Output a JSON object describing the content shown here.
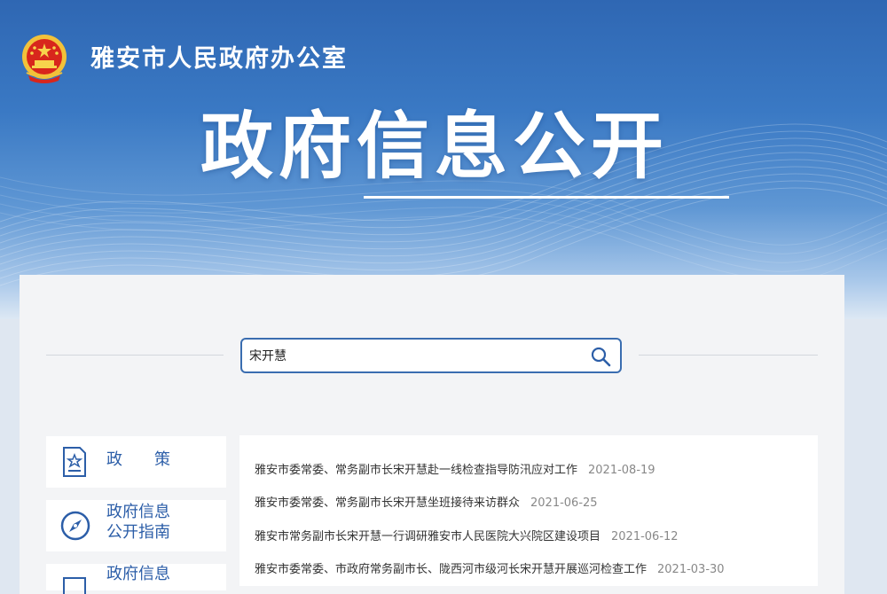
{
  "header": {
    "org_name": "雅安市人民政府办公室",
    "page_title": "政府信息公开"
  },
  "search": {
    "value": "宋开慧",
    "placeholder": ""
  },
  "sidebar": {
    "items": [
      {
        "label": "政　　策",
        "icon": "document-star-icon"
      },
      {
        "label_line1": "政府信息",
        "label_line2": "公开指南",
        "icon": "compass-icon"
      },
      {
        "label_line1": "政府信息",
        "icon": "document-icon"
      }
    ]
  },
  "news": {
    "items": [
      {
        "title": "雅安市委常委、常务副市长宋开慧赴一线检查指导防汛应对工作",
        "date": "2021-08-19"
      },
      {
        "title": "雅安市委常委、常务副市长宋开慧坐班接待来访群众",
        "date": "2021-06-25"
      },
      {
        "title": "雅安市常务副市长宋开慧一行调研雅安市人民医院大兴院区建设项目",
        "date": "2021-06-12"
      },
      {
        "title": "雅安市委常委、市政府常务副市长、陇西河市级河长宋开慧开展巡河检查工作",
        "date": "2021-03-30"
      }
    ]
  },
  "colors": {
    "banner_blue": "#2f67b3",
    "accent_blue": "#2c5ea8",
    "date_gray": "#888888"
  }
}
